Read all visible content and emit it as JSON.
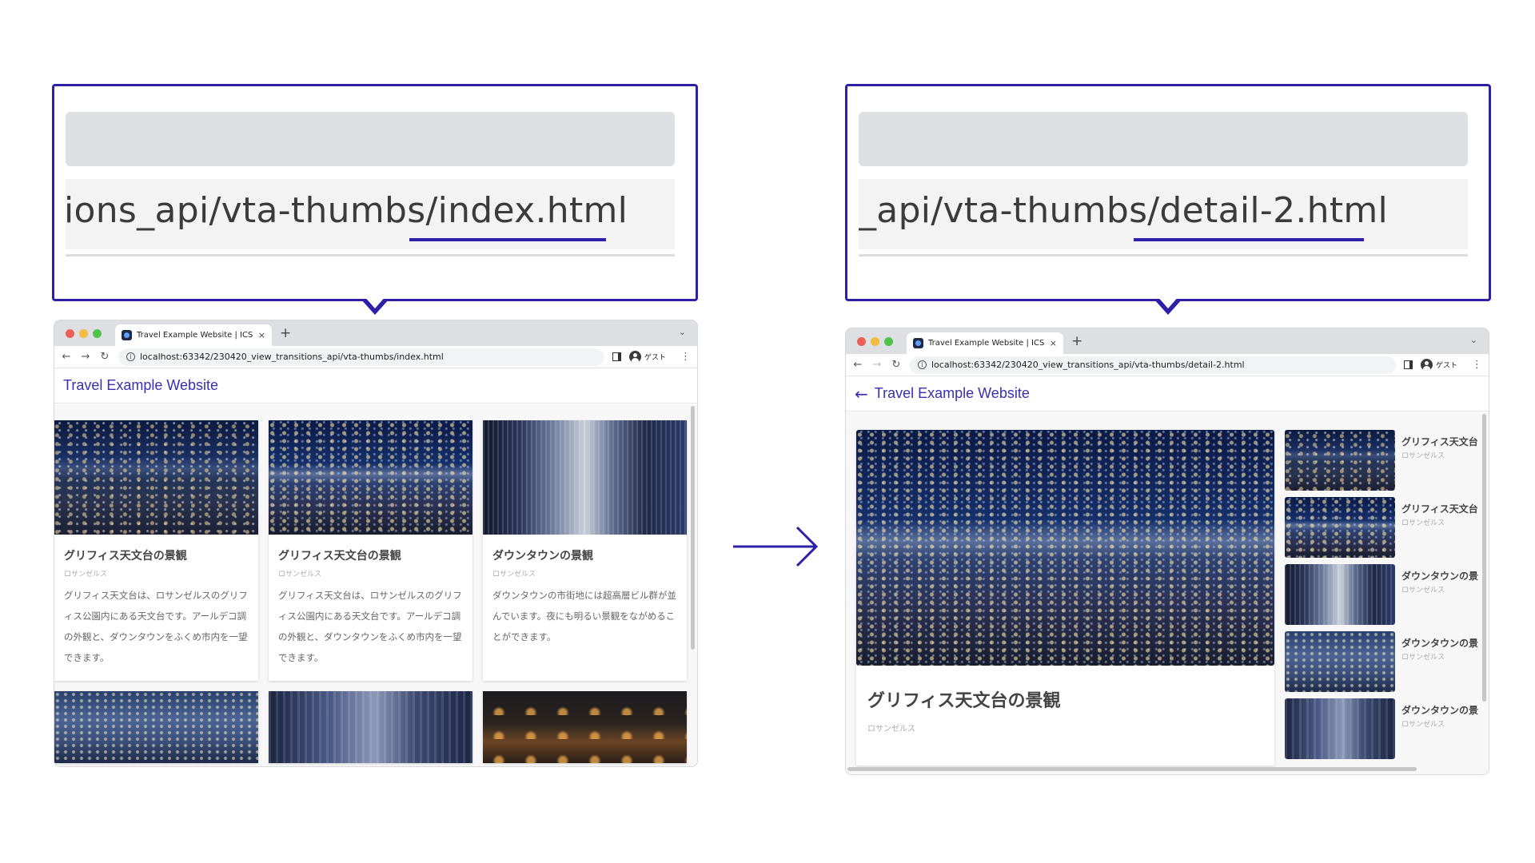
{
  "callouts": {
    "left_url": "ions_api/vta-thumbs/index.html",
    "right_url": "_api/vta-thumbs/detail-2.html"
  },
  "colors": {
    "accent": "#2e21a8",
    "site_title": "#3a2fb0",
    "traffic_red": "#ec5f55",
    "traffic_yellow": "#f3bb3f",
    "traffic_green": "#4fc24a"
  },
  "flow_arrow": "right-arrow-icon",
  "left_browser": {
    "tab_title": "Travel Example Website | ICS",
    "tab_close": "×",
    "new_tab": "+",
    "tab_chevron": "⌄",
    "address": "localhost:63342/230420_view_transitions_api/vta-thumbs/index.html",
    "guest": "ゲスト",
    "site_title": "Travel Example Website",
    "cards": [
      {
        "title": "グリフィス天文台の景観",
        "location": "ロサンゼルス",
        "description": "グリフィス天文台は、ロサンゼルスのグリフィス公園内にある天文台です。アールデコ調の外観と、ダウンタウンをふくめ市内を一望できます。"
      },
      {
        "title": "グリフィス天文台の景観",
        "location": "ロサンゼルス",
        "description": "グリフィス天文台は、ロサンゼルスのグリフィス公園内にある天文台です。アールデコ調の外観と、ダウンタウンをふくめ市内を一望できます。"
      },
      {
        "title": "ダウンタウンの景観",
        "location": "ロサンゼルス",
        "description": "ダウンタウンの市街地には超高層ビル群が並んでいます。夜にも明るい景観をながめることができます。"
      }
    ]
  },
  "right_browser": {
    "tab_title": "Travel Example Website | ICS",
    "tab_close": "×",
    "new_tab": "+",
    "tab_chevron": "⌄",
    "address": "localhost:63342/230420_view_transitions_api/vta-thumbs/detail-2.html",
    "guest": "ゲスト",
    "site_title": "Travel Example Website",
    "detail": {
      "title": "グリフィス天文台の景観",
      "location": "ロサンゼルス"
    },
    "thumbs": [
      {
        "title": "グリフィス天文台",
        "location": "ロサンゼルス"
      },
      {
        "title": "グリフィス天文台",
        "location": "ロサンゼルス"
      },
      {
        "title": "ダウンタウンの景",
        "location": "ロサンゼルス"
      },
      {
        "title": "ダウンタウンの景",
        "location": "ロサンゼルス"
      },
      {
        "title": "ダウンタウンの景",
        "location": "ロサンゼルス"
      }
    ]
  }
}
